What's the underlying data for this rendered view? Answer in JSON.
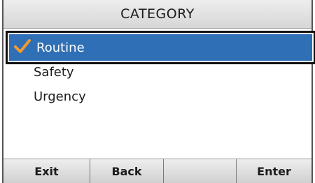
{
  "header": {
    "title": "CATEGORY"
  },
  "list": {
    "items": [
      {
        "label": "Routine",
        "selected": true
      },
      {
        "label": "Safety",
        "selected": false
      },
      {
        "label": "Urgency",
        "selected": false
      }
    ]
  },
  "softkeys": [
    {
      "label": "Exit"
    },
    {
      "label": "Back"
    },
    {
      "label": ""
    },
    {
      "label": "Enter"
    }
  ],
  "colors": {
    "selection": "#2f6fb5",
    "checkmark": "#f39a2e",
    "selected_text": "#ffffff"
  },
  "icons": {
    "selected_marker": "checkmark-icon"
  }
}
